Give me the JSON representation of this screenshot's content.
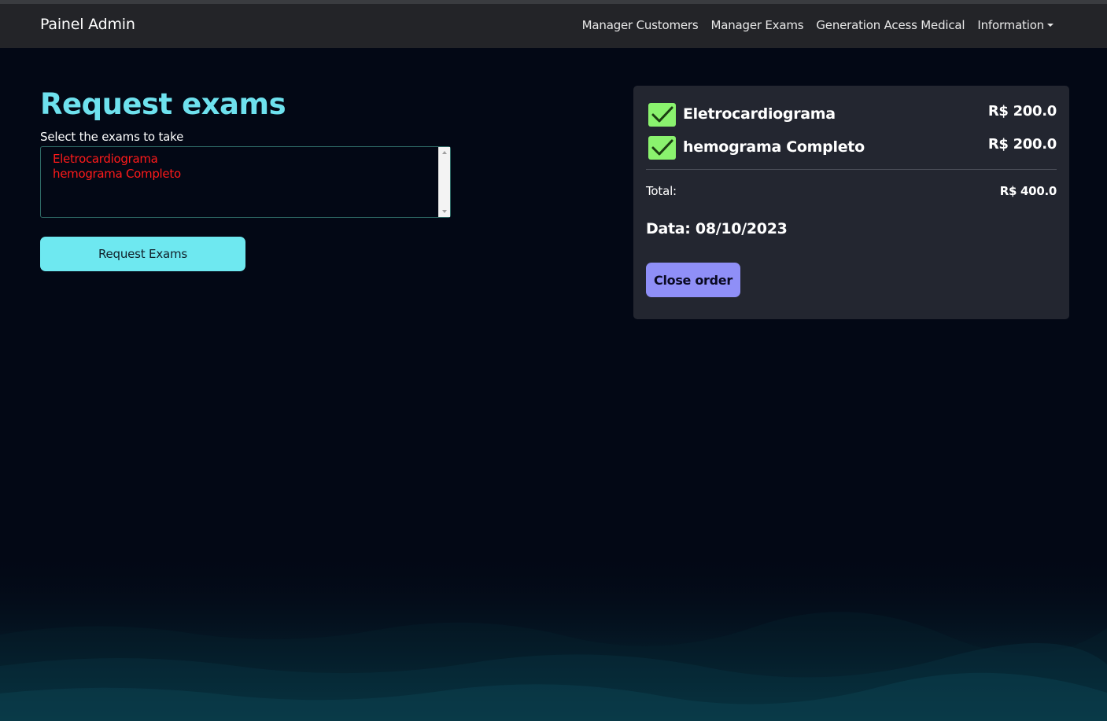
{
  "navbar": {
    "brand": "Painel Admin",
    "links": [
      {
        "label": "Manager Customers"
      },
      {
        "label": "Manager Exams"
      },
      {
        "label": "Generation Acess Medical"
      },
      {
        "label": "Information"
      }
    ]
  },
  "request": {
    "title": "Request exams",
    "select_label": "Select the exams to take",
    "options": [
      "Eletrocardiograma",
      "hemograma Completo"
    ],
    "button_label": "Request Exams"
  },
  "order": {
    "items": [
      {
        "name": "Eletrocardiograma",
        "price": "R$ 200.0",
        "checked": true
      },
      {
        "name": "hemograma Completo",
        "price": "R$ 200.0",
        "checked": true
      }
    ],
    "total_label": "Total:",
    "total_value": "R$ 400.0",
    "date": "Data: 08/10/2023",
    "close_label": "Close order"
  },
  "icons": {
    "check": "check-icon",
    "dropdown": "caret-down-icon"
  },
  "colors": {
    "accent": "#6ee1ee",
    "check": "#8af26e",
    "close_button": "#8f8ff7",
    "option_text": "#ff1a1a"
  }
}
